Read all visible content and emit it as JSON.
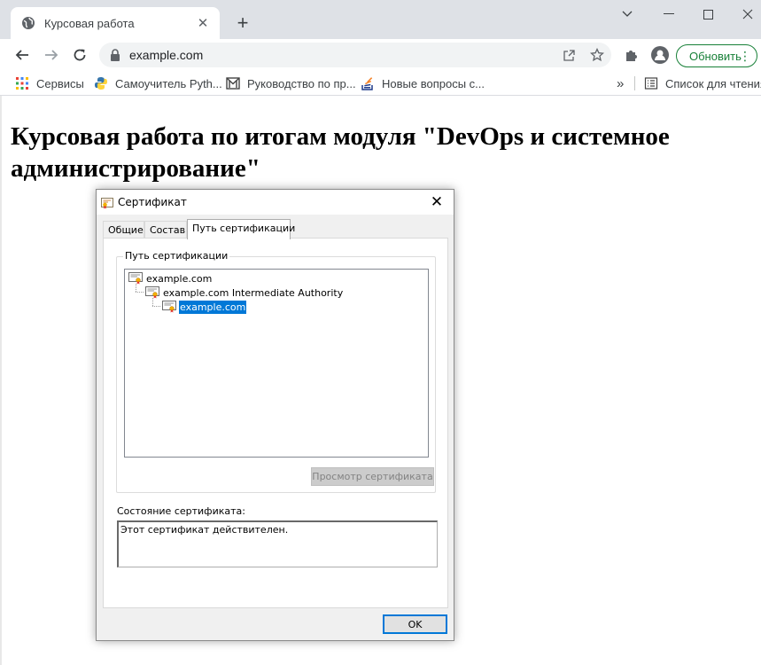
{
  "browser": {
    "tab": {
      "title": "Курсовая работа"
    },
    "address": {
      "url": "example.com"
    },
    "update_label": "Обновить",
    "bookmarks": [
      {
        "label": "Сервисы",
        "icon": "apps-grid-icon"
      },
      {
        "label": "Самоучитель Pyth...",
        "icon": "python-icon"
      },
      {
        "label": "Руководство по пр...",
        "icon": "gmail-icon"
      },
      {
        "label": "Новые вопросы с...",
        "icon": "stackoverflow-icon"
      }
    ],
    "reading_list_label": "Список для чтения",
    "more_bookmarks": "»"
  },
  "page": {
    "heading": "Курсовая работа по итогам модуля \"DevOps и системное администрирование\""
  },
  "dialog": {
    "title": "Сертификат",
    "tabs": [
      {
        "label": "Общие"
      },
      {
        "label": "Состав"
      },
      {
        "label": "Путь сертификации",
        "active": true
      }
    ],
    "group_label": "Путь сертификации",
    "tree": [
      {
        "label": "example.com",
        "level": 0
      },
      {
        "label": "example.com Intermediate Authority",
        "level": 1
      },
      {
        "label": "example.com",
        "level": 2,
        "selected": true
      }
    ],
    "view_button": "Просмотр сертификата",
    "status_label": "Состояние сертификата:",
    "status_text": "Этот сертификат действителен.",
    "ok_button": "OK"
  },
  "colors": {
    "accent": "#0078d7",
    "update_green": "#188038",
    "titlebar": "#dee1e6"
  }
}
